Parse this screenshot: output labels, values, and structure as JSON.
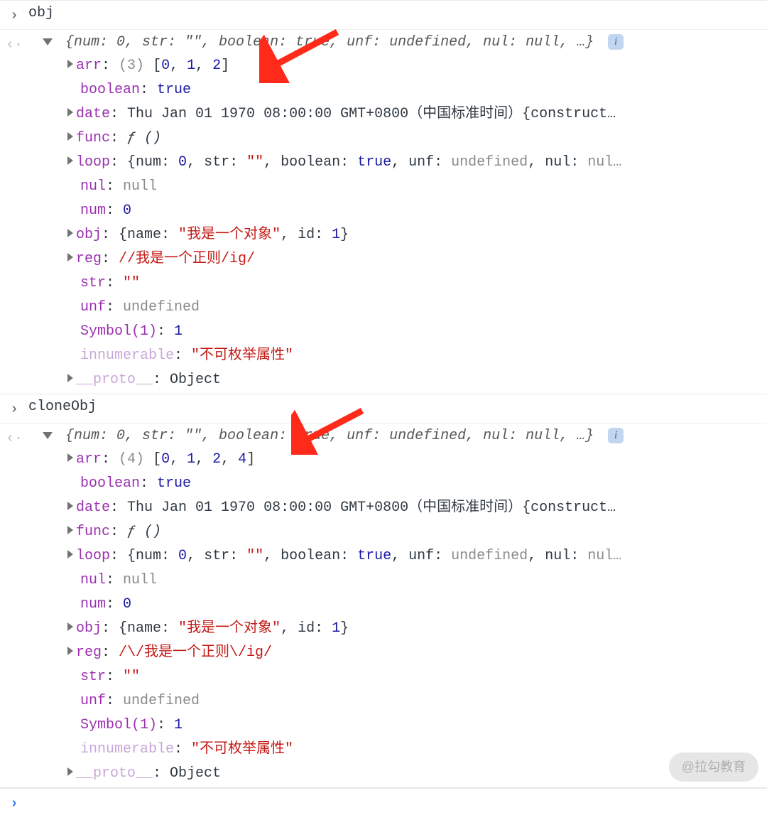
{
  "obj": {
    "name": "obj",
    "summary": "{num: 0, str: \"\", boolean: true, unf: undefined, nul: null, …}",
    "props": {
      "arr": {
        "key": "arr",
        "count": "(3)",
        "val": "[0, 1, 2]",
        "expandable": true
      },
      "boolean": {
        "key": "boolean",
        "val": "true"
      },
      "date": {
        "key": "date",
        "val": "Thu Jan 01 1970 08:00:00 GMT+0800（中国标准时间）{construct…",
        "expandable": true,
        "plain": true
      },
      "func": {
        "key": "func",
        "val_italic": "ƒ ()",
        "expandable": true
      },
      "loop": {
        "key": "loop",
        "val_obj": "{num: 0, str: \"\", boolean: true, unf: undefined, nul: nul…",
        "expandable": true
      },
      "nul": {
        "key": "nul",
        "val_gray": "null"
      },
      "num": {
        "key": "num",
        "val_blue": "0"
      },
      "obj": {
        "key": "obj",
        "val_objmix": true,
        "name": "我是一个对象",
        "id": "1",
        "expandable": true
      },
      "reg": {
        "key": "reg",
        "val_red": "//我是一个正则/ig/",
        "expandable": true
      },
      "str": {
        "key": "str",
        "val_red": "\"\""
      },
      "unf": {
        "key": "unf",
        "val_gray": "undefined"
      },
      "symbol": {
        "key": "Symbol(1)",
        "val_blue": "1"
      },
      "innum": {
        "key": "innumerable",
        "faded": true,
        "val_red": "\"不可枚举属性\""
      },
      "proto": {
        "key": "__proto__",
        "faded": true,
        "val": "Object",
        "expandable": true,
        "plain": true
      }
    }
  },
  "cloneObj": {
    "name": "cloneObj",
    "summary": "{num: 0, str: \"\", boolean: true, unf: undefined, nul: null, …}",
    "props": {
      "arr": {
        "key": "arr",
        "count": "(4)",
        "val": "[0, 1, 2, 4]",
        "expandable": true
      },
      "boolean": {
        "key": "boolean",
        "val": "true"
      },
      "date": {
        "key": "date",
        "val": "Thu Jan 01 1970 08:00:00 GMT+0800（中国标准时间）{construct…",
        "expandable": true,
        "plain": true
      },
      "func": {
        "key": "func",
        "val_italic": "ƒ ()",
        "expandable": true
      },
      "loop": {
        "key": "loop",
        "val_obj": "{num: 0, str: \"\", boolean: true, unf: undefined, nul: nul…",
        "expandable": true
      },
      "nul": {
        "key": "nul",
        "val_gray": "null"
      },
      "num": {
        "key": "num",
        "val_blue": "0"
      },
      "obj": {
        "key": "obj",
        "val_objmix": true,
        "name": "我是一个对象",
        "id": "1",
        "expandable": true
      },
      "reg": {
        "key": "reg",
        "val_red": "/\\/我是一个正则\\/ig/",
        "expandable": true
      },
      "str": {
        "key": "str",
        "val_red": "\"\""
      },
      "unf": {
        "key": "unf",
        "val_gray": "undefined"
      },
      "symbol": {
        "key": "Symbol(1)",
        "val_blue": "1"
      },
      "innum": {
        "key": "innumerable",
        "faded": true,
        "val_red": "\"不可枚举属性\""
      },
      "proto": {
        "key": "__proto__",
        "faded": true,
        "val": "Object",
        "expandable": true,
        "plain": true
      }
    }
  },
  "watermark": "@拉勾教育",
  "prompt": "›"
}
